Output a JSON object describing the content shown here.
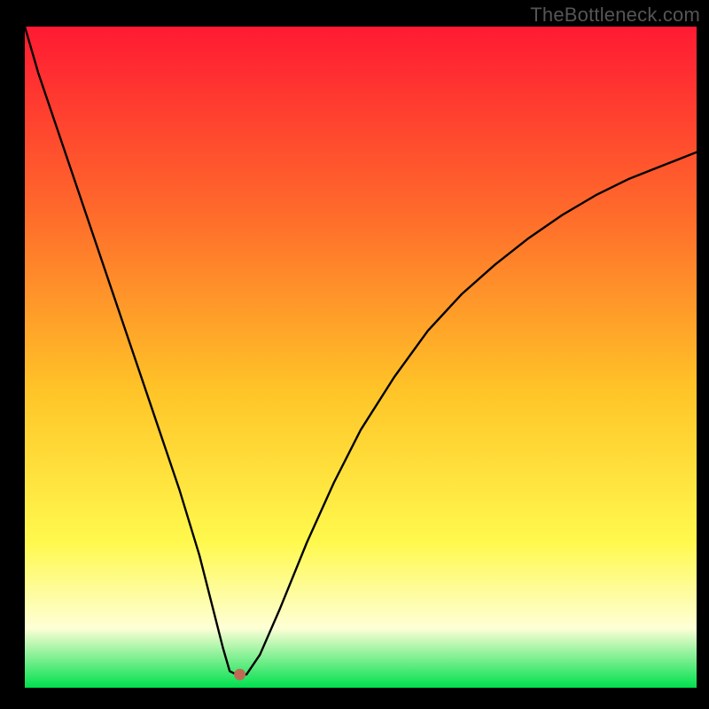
{
  "watermark": "TheBottleneck.com",
  "colors": {
    "background_black": "#000000",
    "gradient_top": "#ff1a33",
    "gradient_mid1": "#ff6a2b",
    "gradient_mid2": "#ffc428",
    "gradient_mid3": "#fff94d",
    "gradient_bottom_yellowwhite": "#feffd6",
    "gradient_green": "#00e04d",
    "curve": "#000000",
    "marker": "#c06a55"
  },
  "chart_data": {
    "type": "line",
    "title": "",
    "xlabel": "",
    "ylabel": "",
    "xlim": [
      0,
      100
    ],
    "ylim": [
      0,
      100
    ],
    "note": "Axes have no tick labels in the source; values are normalized 0–100. Curve resembles a bottleneck/absolute-difference style dip.",
    "grid": false,
    "legend": false,
    "marker": {
      "x": 32,
      "y": 2
    },
    "x": [
      0,
      2,
      5,
      8,
      11,
      14,
      17,
      20,
      23,
      26,
      28,
      29.5,
      30.5,
      31.5,
      33,
      35,
      38,
      42,
      46,
      50,
      55,
      60,
      65,
      70,
      75,
      80,
      85,
      90,
      95,
      100
    ],
    "y": [
      100,
      93,
      84,
      75,
      66,
      57,
      48,
      39,
      30,
      20,
      12,
      6,
      2.5,
      2,
      2,
      5,
      12,
      22,
      31,
      39,
      47,
      54,
      59.5,
      64,
      68,
      71.5,
      74.5,
      77,
      79,
      81
    ]
  }
}
